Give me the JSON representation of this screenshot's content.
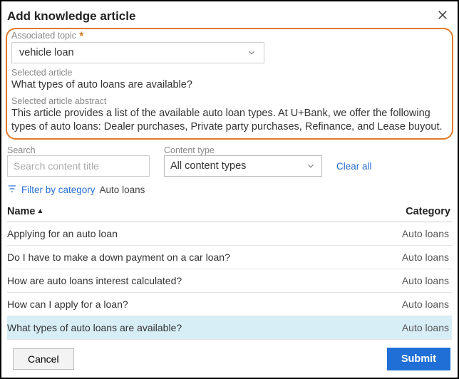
{
  "modal": {
    "title": "Add knowledge article",
    "topic_label": "Associated topic",
    "topic_value": "vehicle loan",
    "selected_article_label": "Selected article",
    "selected_article_value": "What types of auto loans are available?",
    "selected_abstract_label": "Selected article abstract",
    "selected_abstract_value": "This article provides a list of the available auto loan types. At U+Bank, we offer the following types of auto loans: Dealer purchases, Private party purchases, Refinance, and Lease buyout."
  },
  "filters": {
    "search_label": "Search",
    "search_placeholder": "Search content title",
    "content_type_label": "Content type",
    "content_type_value": "All content types",
    "clear_all": "Clear all",
    "filter_by_category": "Filter by category",
    "category_value": "Auto loans"
  },
  "table": {
    "col_name": "Name",
    "col_category": "Category",
    "rows": [
      {
        "name": "Applying for an auto loan",
        "category": "Auto loans"
      },
      {
        "name": "Do I have to make a down payment on a car loan?",
        "category": "Auto loans"
      },
      {
        "name": "How are auto loans interest calculated?",
        "category": "Auto loans"
      },
      {
        "name": "How can I apply for a loan?",
        "category": "Auto loans"
      },
      {
        "name": "What types of auto loans are available?",
        "category": "Auto loans"
      }
    ]
  },
  "actions": {
    "cancel": "Cancel",
    "submit": "Submit"
  }
}
